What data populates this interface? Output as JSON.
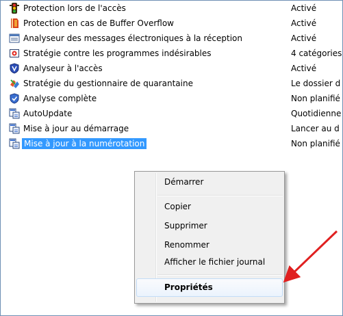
{
  "list": {
    "rows": [
      {
        "name": "Protection lors de l'accès",
        "status": "Activé",
        "icon": "traffic-light-icon"
      },
      {
        "name": "Protection en cas de Buffer Overflow",
        "status": "Activé",
        "icon": "shield-red-icon"
      },
      {
        "name": "Analyseur des messages électroniques à la réception",
        "status": "Activé",
        "icon": "email-scanner-icon"
      },
      {
        "name": "Stratégie contre les programmes indésirables",
        "status": "4 catégories",
        "icon": "pup-strategy-icon"
      },
      {
        "name": "Analyseur à l'accès",
        "status": "Activé",
        "icon": "shield-blue-icon"
      },
      {
        "name": "Stratégie du gestionnaire de quarantaine",
        "status": "Le dossier d",
        "icon": "quarantine-icon"
      },
      {
        "name": "Analyse complète",
        "status": "Non planifié",
        "icon": "shield-check-icon"
      },
      {
        "name": "AutoUpdate",
        "status": "Quotidienne",
        "icon": "update-icon"
      },
      {
        "name": "Mise à jour au démarrage",
        "status": "Lancer au d",
        "icon": "update-icon"
      },
      {
        "name": "Mise à jour à la numérotation",
        "status": "Non planifié",
        "icon": "update-icon"
      }
    ]
  },
  "context_menu": {
    "items": [
      "Démarrer",
      "Copier",
      "Supprimer",
      "Renommer",
      "Afficher le fichier journal",
      "Propriétés"
    ]
  },
  "colors": {
    "selection": "#3399ff",
    "arrow": "#e02020"
  }
}
